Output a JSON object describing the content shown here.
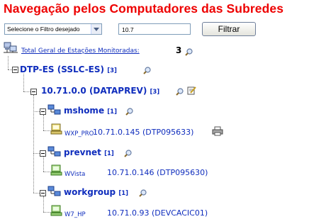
{
  "page": {
    "title": "Navegação pelos Computadores das Subredes"
  },
  "filter": {
    "select_value": "Selecione o Filtro desejado",
    "input_value": "10.7",
    "button_label": "Filtrar"
  },
  "summary": {
    "label": "Total Geral de Estações Monitoradas:",
    "count": "3"
  },
  "tree": {
    "root": {
      "label": "DTP-ES (SSLC-ES)",
      "count": "[3]"
    },
    "network": {
      "label": "10.71.0.0 (DATAPREV)",
      "count": "[3]"
    },
    "groups": [
      {
        "label": "mshome",
        "count": "[1]",
        "host": {
          "name": "WXP_PRO",
          "address": "10.71.0.145 (DTP095633)"
        }
      },
      {
        "label": "prevnet",
        "count": "[1]",
        "host": {
          "name": "WVista",
          "address": "10.71.0.146 (DTP095630)"
        }
      },
      {
        "label": "workgroup",
        "count": "[1]",
        "host": {
          "name": "W7_HP",
          "address": "10.71.0.93 (DEVCACIC01)"
        }
      }
    ]
  },
  "colors": {
    "title": "#ee0000",
    "link": "#0f2dbd"
  }
}
